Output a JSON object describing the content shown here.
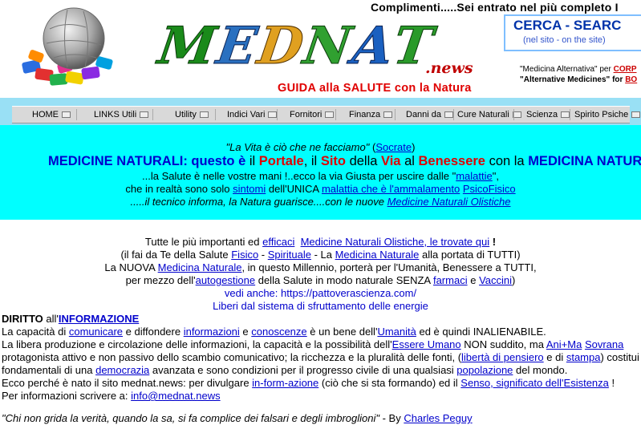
{
  "header": {
    "congrats": "Complimenti.....Sei entrato nel più completo I",
    "logo_text": "MEDNAT",
    "logo_suffix": ".news",
    "tagline": "GUIDA  alla  SALUTE con la Natura",
    "search_title": "CERCA  -  SEARC",
    "search_sub": "(nel sito - on the site)",
    "alt_med_1": "\"Medicina Alternativa\"  per",
    "alt_med_1_link": "CORP",
    "alt_med_2": "\"Alternative Medicines\"  for",
    "alt_med_2_link": "BO"
  },
  "nav": {
    "items": [
      {
        "label": "HOME"
      },
      {
        "label": "LINKS Utili"
      },
      {
        "label": "Utility"
      },
      {
        "label": "Indici Vari"
      },
      {
        "label": "Fornitori"
      },
      {
        "label": "Finanza"
      },
      {
        "label": "Danni da"
      },
      {
        "label": "Cure Naturali"
      },
      {
        "label": "Scienza"
      },
      {
        "label": "Spirito Psiche"
      }
    ]
  },
  "banner": {
    "quote": "La Vita è ciò che ne facciamo",
    "quote_author": "Socrate",
    "h_part1": "MEDICINE NATURALI: questo è",
    "h_il1": " il ",
    "h_portale": "Portale",
    "h_comma": ", il ",
    "h_sito": "Sito",
    "h_della": " della ",
    "h_via": "Via",
    "h_al": " al ",
    "h_benessere": "Benessere",
    "h_con": " con la ",
    "h_medicina": "MEDICINA NATURAL",
    "line3_pre": "...la Salute è nelle vostre mani !..ecco la via Giusta per uscire dalle \"",
    "line3_link": "malattie",
    "line3_post": "\",",
    "line4_pre": "che in realtà sono solo ",
    "line4_link1": "sintomi",
    "line4_mid": " dell'UNICA ",
    "line4_link2": "malattia che è l'ammalamento",
    "line4_link3": "PsicoFisico",
    "line5_pre": ".....il tecnico informa, la Natura guarisce....con le nuove ",
    "line5_link": "Medicine Naturali Olistiche"
  },
  "content": {
    "p1_pre": "Tutte le più importanti ed ",
    "p1_link1": "efficaci",
    "p1_link2": "Medicine Naturali Olistiche, le trovate qui",
    "p1_post": " !",
    "p2_pre": "(il fai da Te della Salute ",
    "p2_link1": "Fisico",
    "p2_dash": " - ",
    "p2_link2": "Spirituale",
    "p2_mid": " - La ",
    "p2_link3": "Medicina Naturale",
    "p2_post": " alla portata di TUTTI)",
    "p3_pre": "La NUOVA ",
    "p3_link": "Medicina Naturale",
    "p3_post": ", in questo Millennio, porterà per l'Umanità, Benessere a TUTTI,",
    "p4_pre": "per mezzo dell'",
    "p4_link1": "autogestione",
    "p4_mid": " della Salute in modo naturale SENZA ",
    "p4_link2": "farmaci",
    "p4_and": " e ",
    "p4_link3": "Vaccini",
    "p4_post": ")",
    "p5": "vedi anche: https://pattoverascienza.com/",
    "p6": "Liberi dal sistema di sfruttamento delle energie",
    "d_title_pre": "DIRITTO",
    "d_title_all": " all'",
    "d_title_link": "INFORMAZIONE",
    "d1_pre": "La capacità di ",
    "d1_l1": "comunicare",
    "d1_m1": " e diffondere ",
    "d1_l2": "informazioni",
    "d1_m2": " e ",
    "d1_l3": "conoscenze",
    "d1_m3": " è un bene dell'",
    "d1_l4": "Umanità",
    "d1_post": " ed è quindi INALIENABILE.",
    "d2_pre": "La libera produzione e circolazione delle informazioni, la capacità e  la possibilità dell'",
    "d2_l1": "Essere Umano",
    "d2_m1": " NON suddito, ma ",
    "d2_l2": "Ani+Ma",
    "d2_l3": "Sovrana",
    "d3_pre": "protagonista attivo e non passivo dello scambio comunicativo;  la ricchezza e la pluralità delle fonti, (",
    "d3_l1": "libertà di pensiero",
    "d3_m1": " e di ",
    "d3_l2": "stampa",
    "d3_post": ") costitui",
    "d4_pre": "fondamentali di una ",
    "d4_l1": "democrazia",
    "d4_m1": " avanzata e sono condizioni per il progresso civile di una qualsiasi ",
    "d4_l2": "popolazione",
    "d4_post": " del mondo.",
    "d5_pre": "Ecco perché è nato il sito mednat.news: per divulgare ",
    "d5_l1": "in-form-azione",
    "d5_m1": " (ciò che si sta formando) ed il ",
    "d5_l2": "Senso, significato dell'Esistenza",
    "d5_post": " !",
    "d6_pre": " Per informazioni scrivere a: ",
    "d6_link": "info@mednat.news",
    "quote_text": "\"Chi non grida la verità, quando la sa, si fa complice dei falsari e degli imbroglioni\"",
    "quote_by": " - By ",
    "quote_author": "Charles Peguy"
  },
  "colors": {
    "banner_bg": "#00ffff",
    "nav_bg": "#99e0f5",
    "link": "#0000cc",
    "accent_red": "#e00000"
  }
}
